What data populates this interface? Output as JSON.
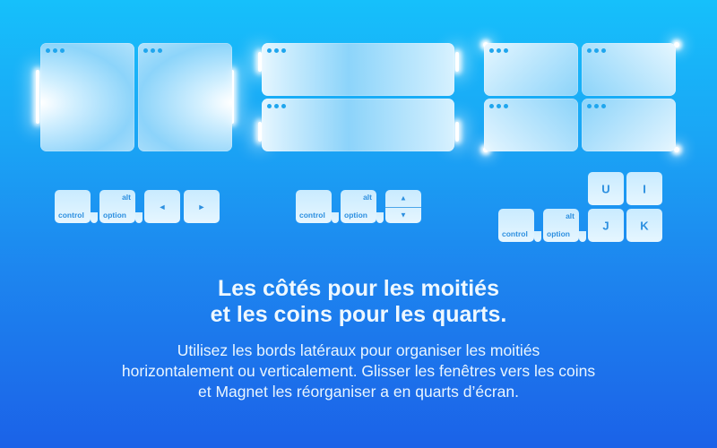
{
  "scene": {
    "layouts": [
      {
        "name": "halves-side",
        "windows": 2,
        "dots_per_window": 3
      },
      {
        "name": "halves-stacked",
        "windows": 2,
        "dots_per_window": 3
      },
      {
        "name": "quarters",
        "windows": 4,
        "dots_per_window": 3
      }
    ],
    "shortcuts": {
      "left_right": {
        "control": "control",
        "alt": "alt",
        "option": "option",
        "left_arrow": "◄",
        "right_arrow": "►"
      },
      "up_down": {
        "control": "control",
        "alt": "alt",
        "option": "option",
        "up_arrow": "▲",
        "down_arrow": "▼"
      },
      "quarters": {
        "control": "control",
        "alt": "alt",
        "option": "option",
        "key_u": "U",
        "key_i": "I",
        "key_j": "J",
        "key_k": "K"
      }
    }
  },
  "headline": {
    "line1": "Les côtés pour les moitiés",
    "line2": "et les coins pour les quarts."
  },
  "description": {
    "line1": "Utilisez les bords latéraux pour organiser les moitiés",
    "line2": "horizontalement ou verticalement. Glisser les fenêtres vers les coins",
    "line3": "et Magnet les réorganiser a en quarts d’écran."
  },
  "colors": {
    "background_top": "#16c0fb",
    "background_bottom": "#1b62e8",
    "key_text": "#2c8fe0",
    "window_dot": "#1fa6ee",
    "headline_text": "#eef8ff"
  }
}
